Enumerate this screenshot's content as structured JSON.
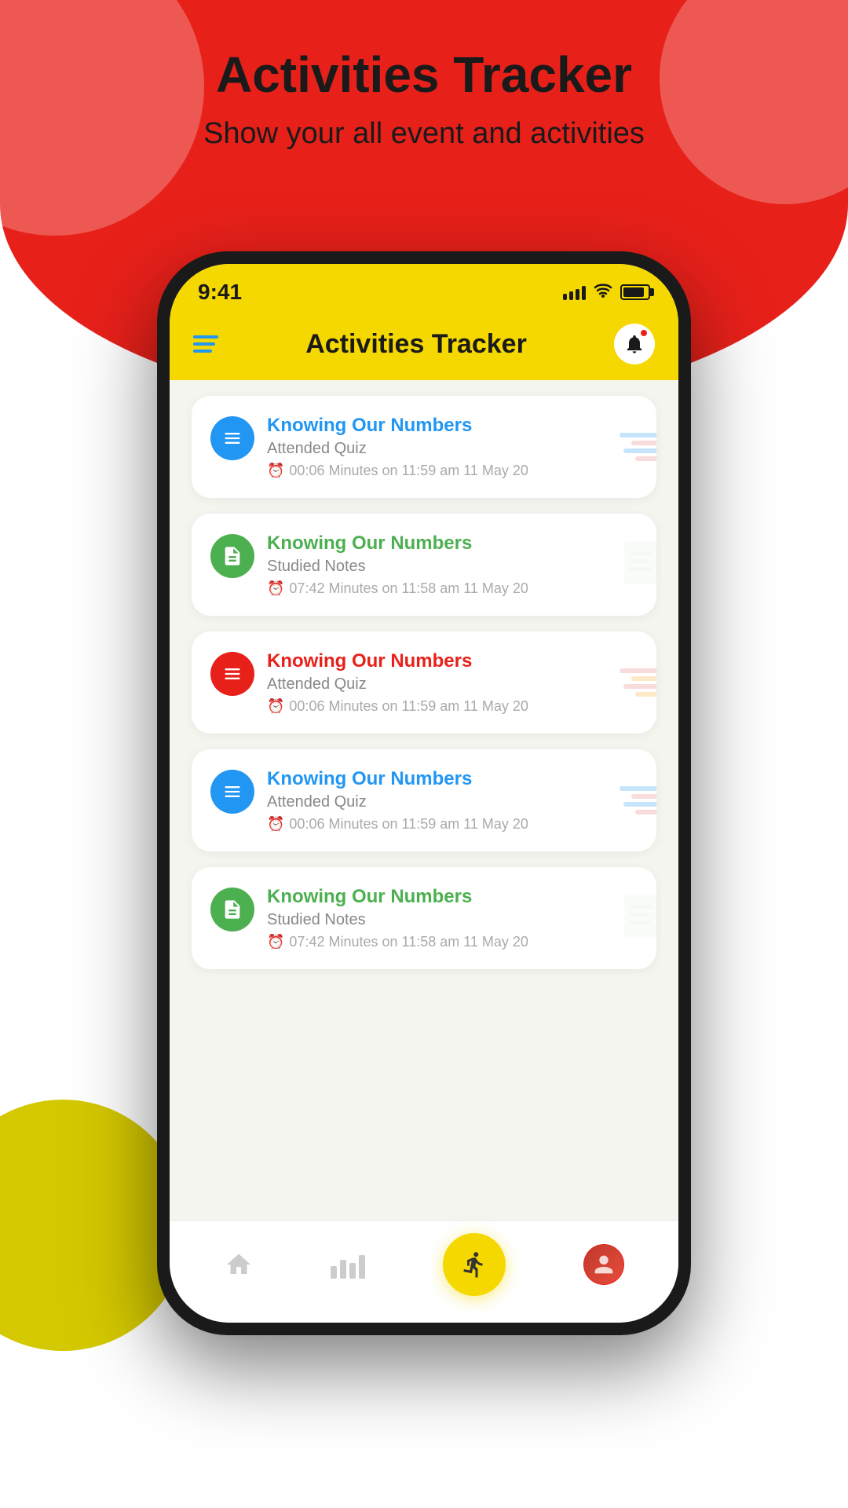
{
  "page": {
    "background": {
      "redBg": "#e8201a",
      "yellowCircle": "#d4c800",
      "white": "#ffffff"
    }
  },
  "header": {
    "title": "Activities Tracker",
    "subtitle": "Show your all event and activities"
  },
  "app": {
    "title": "Activities Tracker",
    "time": "9:41",
    "notifications": true
  },
  "activities": [
    {
      "id": 1,
      "title": "Knowing Our Numbers",
      "type": "Attended Quiz",
      "iconColor": "blue",
      "iconType": "quiz",
      "time": "00:06 Minutes on 11:59 am 11 May 20"
    },
    {
      "id": 2,
      "title": "Knowing Our Numbers",
      "type": "Studied Notes",
      "iconColor": "green",
      "iconType": "notes",
      "time": "07:42 Minutes on 11:58 am 11 May 20"
    },
    {
      "id": 3,
      "title": "Knowing Our Numbers",
      "type": "Attended Quiz",
      "iconColor": "red",
      "iconType": "quiz",
      "time": "00:06 Minutes on 11:59 am 11 May 20"
    },
    {
      "id": 4,
      "title": "Knowing Our Numbers",
      "type": "Attended Quiz",
      "iconColor": "blue",
      "iconType": "quiz",
      "time": "00:06 Minutes on 11:59 am 11 May 20"
    },
    {
      "id": 5,
      "title": "Knowing Our Numbers",
      "type": "Studied Notes",
      "iconColor": "green",
      "iconType": "notes",
      "time": "07:42 Minutes on 11:58 am 11 May 20"
    }
  ],
  "nav": {
    "home_label": "Home",
    "stats_label": "Stats",
    "activity_label": "Activity",
    "profile_label": "Profile"
  }
}
